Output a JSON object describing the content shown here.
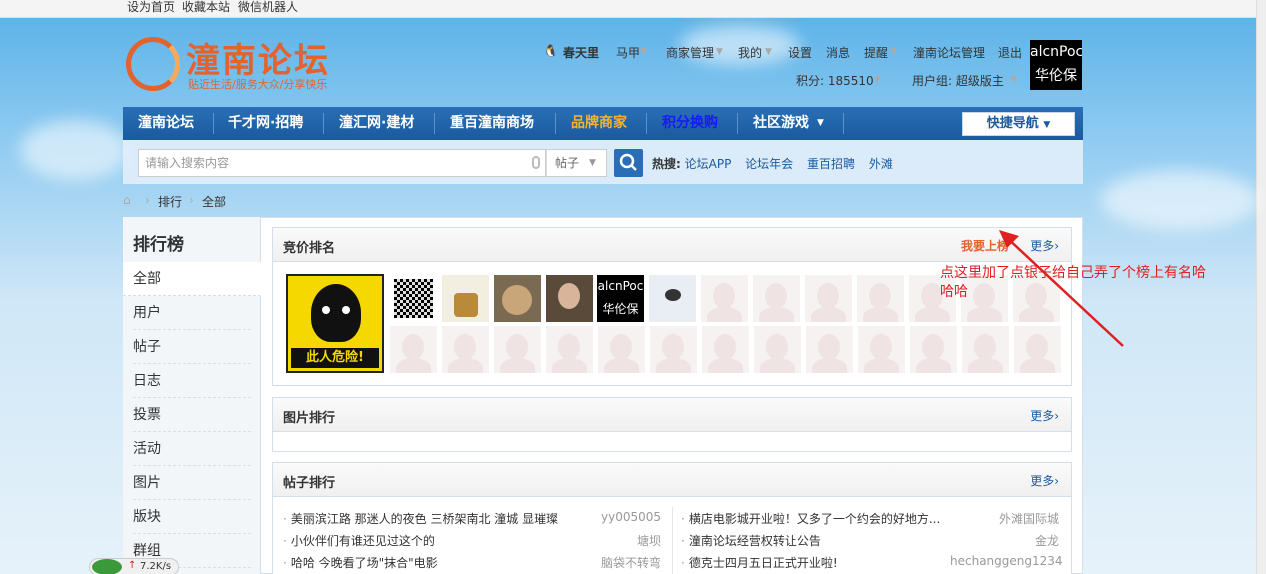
{
  "topbar": {
    "set_home": "设为首页",
    "bookmark": "收藏本站",
    "wechat_bot": "微信机器人"
  },
  "logo": {
    "name": "潼南论坛",
    "slogan": "贴近生活/服务大众/分享快乐"
  },
  "user": {
    "name": "春天里",
    "items": [
      "马甲",
      "商家管理",
      "我的",
      "设置",
      "消息",
      "提醒",
      "潼南论坛管理",
      "退出"
    ],
    "points": "积分: 185510",
    "group": "用户组: 超级版主",
    "avatar_text_1": "alcnPoc",
    "avatar_text_2": "华伦保泰"
  },
  "nav": {
    "items": [
      "潼南论坛",
      "千才网·招聘",
      "潼汇网·建材",
      "重百潼南商场",
      "品牌商家",
      "积分换购",
      "社区游戏"
    ],
    "quick": "快捷导航"
  },
  "search": {
    "placeholder": "请输入搜索内容",
    "type": "帖子",
    "hot_label": "热搜:",
    "hot": [
      "论坛APP",
      "论坛年会",
      "重百招聘",
      "外滩"
    ]
  },
  "breadcrumb": [
    "排行",
    "全部"
  ],
  "sidebar": {
    "title": "排行榜",
    "items": [
      "全部",
      "用户",
      "帖子",
      "日志",
      "投票",
      "活动",
      "图片",
      "版块",
      "群组"
    ]
  },
  "bid": {
    "title": "竞价排名",
    "apply": "我要上榜",
    "more": "更多›",
    "first_text": "此人危险!"
  },
  "pics": {
    "title": "图片排行",
    "more": "更多›"
  },
  "posts": {
    "title": "帖子排行",
    "more": "更多›",
    "left": [
      {
        "title": "美丽滨江路 那迷人的夜色 三桥架南北 潼城 显璀璨",
        "author": "yy005005"
      },
      {
        "title": "小伙伴们有谁还见过这个的",
        "author": "塘坝"
      },
      {
        "title": "哈哈 今晚看了场\"抹合\"电影",
        "author": "脑袋不转弯"
      }
    ],
    "right": [
      {
        "title": "横店电影城开业啦！又多了一个约会的好地方...",
        "author": "外滩国际城"
      },
      {
        "title": "潼南论坛经营权转让公告",
        "author": "金龙"
      },
      {
        "title": "德克士四月五日正式开业啦!",
        "author": "hechanggeng1234"
      }
    ]
  },
  "annotation": "点这里加了点银子给自己弄了个榜上有名哈哈哈",
  "download": "7.2K/s",
  "colors": {
    "nav": "#1a5a9e",
    "accent": "#e2632b",
    "annotation": "#e02020"
  }
}
